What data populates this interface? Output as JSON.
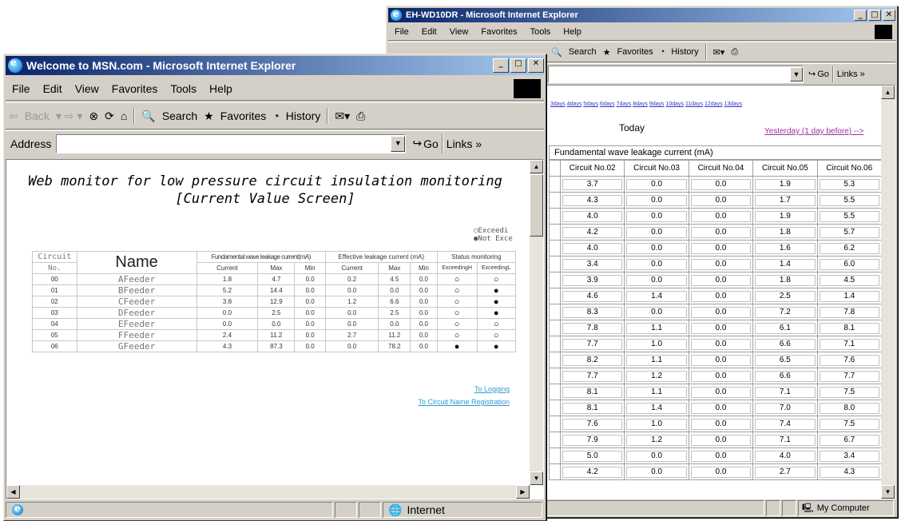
{
  "back_window": {
    "title": "EH-WD10DR - Microsoft Internet Explorer",
    "menu": [
      "File",
      "Edit",
      "View",
      "Favorites",
      "Tools",
      "Help"
    ],
    "toolbar": {
      "search": "Search",
      "favorites": "Favorites",
      "history": "History"
    },
    "address": {
      "go": "Go",
      "links": "Links »"
    },
    "day_links": [
      "3days",
      "4days",
      "5days",
      "6days",
      "7days",
      "8days",
      "9days",
      "10days",
      "11days",
      "12days",
      "13days"
    ],
    "today_label": "Today",
    "yesterday_link": "Yesterday (1 day before) -->",
    "table_title": "Fundamental wave leakage current (mA)",
    "columns": [
      "Circuit No.02",
      "Circuit No.03",
      "Circuit No.04",
      "Circuit No.05",
      "Circuit No.06"
    ],
    "rows": [
      [
        "3.7",
        "0.0",
        "0.0",
        "1.9",
        "5.3"
      ],
      [
        "4.3",
        "0.0",
        "0.0",
        "1.7",
        "5.5"
      ],
      [
        "4.0",
        "0.0",
        "0.0",
        "1.9",
        "5.5"
      ],
      [
        "4.2",
        "0.0",
        "0.0",
        "1.8",
        "5.7"
      ],
      [
        "4.0",
        "0.0",
        "0.0",
        "1.6",
        "6.2"
      ],
      [
        "3.4",
        "0.0",
        "0.0",
        "1.4",
        "6.0"
      ],
      [
        "3.9",
        "0.0",
        "0.0",
        "1.8",
        "4.5"
      ],
      [
        "4.6",
        "1.4",
        "0.0",
        "2.5",
        "1.4"
      ],
      [
        "8.3",
        "0.0",
        "0.0",
        "7.2",
        "7.8"
      ],
      [
        "7.8",
        "1.1",
        "0.0",
        "6.1",
        "8.1"
      ],
      [
        "7.7",
        "1.0",
        "0.0",
        "6.6",
        "7.1"
      ],
      [
        "8.2",
        "1.1",
        "0.0",
        "6.5",
        "7.6"
      ],
      [
        "7.7",
        "1.2",
        "0.0",
        "6.6",
        "7.7"
      ],
      [
        "8.1",
        "1.1",
        "0.0",
        "7.1",
        "7.5"
      ],
      [
        "8.1",
        "1.4",
        "0.0",
        "7.0",
        "8.0"
      ],
      [
        "7.6",
        "1.0",
        "0.0",
        "7.4",
        "7.5"
      ],
      [
        "7.9",
        "1.2",
        "0.0",
        "7.1",
        "6.7"
      ],
      [
        "5.0",
        "0.0",
        "0.0",
        "4.0",
        "3.4"
      ],
      [
        "4.2",
        "0.0",
        "0.0",
        "2.7",
        "4.3"
      ]
    ],
    "status_zone": "My Computer"
  },
  "front_window": {
    "title": "Welcome to MSN.com - Microsoft Internet Explorer",
    "menu": [
      "File",
      "Edit",
      "View",
      "Favorites",
      "Tools",
      "Help"
    ],
    "toolbar": {
      "back": "Back",
      "search": "Search",
      "favorites": "Favorites",
      "history": "History"
    },
    "address": {
      "label": "Address",
      "value": "",
      "go": "Go",
      "links": "Links »"
    },
    "page_heading": "Web monitor for low pressure circuit insulation monitoring [Current Value Screen]",
    "legend": [
      "○Exceedi",
      "●Not Exce"
    ],
    "table": {
      "col_circuit": "Circuit",
      "col_no": "No.",
      "col_name": "Name",
      "group_fund": "Fundamental wave leakage current(mA)",
      "group_eff": "Effective leakage current (mA)",
      "group_status": "Status monitoring",
      "sub": [
        "Current",
        "Max",
        "Min",
        "Current",
        "Max",
        "Min",
        "ExceedingH",
        "ExceedingL"
      ],
      "rows": [
        {
          "no": "00",
          "name": "AFeeder",
          "v": [
            "1.8",
            "4.7",
            "0.0",
            "0.2",
            "4.5",
            "0.0"
          ],
          "s": [
            "○",
            "○"
          ]
        },
        {
          "no": "01",
          "name": "BFeeder",
          "v": [
            "5.2",
            "14.4",
            "0.0",
            "0.0",
            "0.0",
            "0.0"
          ],
          "s": [
            "○",
            "●"
          ]
        },
        {
          "no": "02",
          "name": "CFeeder",
          "v": [
            "3.8",
            "12.9",
            "0.0",
            "1.2",
            "6.6",
            "0.0"
          ],
          "s": [
            "○",
            "●"
          ]
        },
        {
          "no": "03",
          "name": "DFeeder",
          "v": [
            "0.0",
            "2.5",
            "0.0",
            "0.0",
            "2.5",
            "0.0"
          ],
          "s": [
            "○",
            "●"
          ]
        },
        {
          "no": "04",
          "name": "EFeeder",
          "v": [
            "0.0",
            "0.0",
            "0.0",
            "0.0",
            "0.0",
            "0.0"
          ],
          "s": [
            "○",
            "○"
          ]
        },
        {
          "no": "05",
          "name": "FFeeder",
          "v": [
            "2.4",
            "11.2",
            "0.0",
            "2.7",
            "11.2",
            "0.0"
          ],
          "s": [
            "○",
            "○"
          ]
        },
        {
          "no": "06",
          "name": "GFeeder",
          "v": [
            "4.3",
            "87.3",
            "0.0",
            "0.0",
            "78.2",
            "0.0"
          ],
          "s": [
            "●",
            "●"
          ]
        }
      ]
    },
    "link_logging": "To Logging",
    "link_registration": "To Circuit Name Registration",
    "status_zone": "Internet"
  }
}
